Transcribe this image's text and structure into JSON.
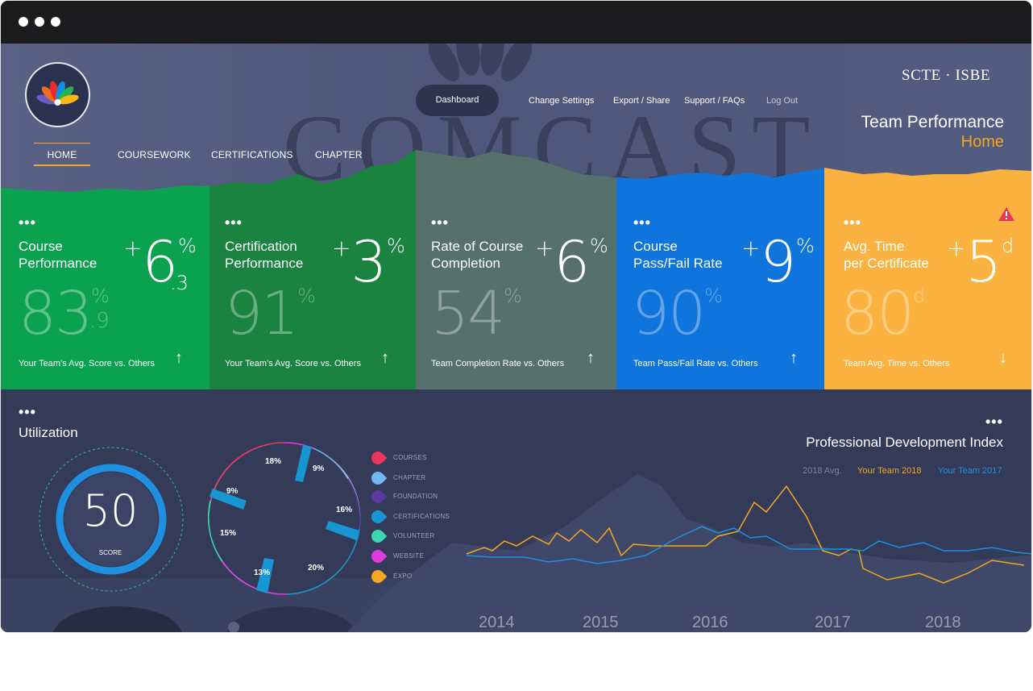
{
  "window": {
    "controls": [
      "close",
      "minimize",
      "maximize"
    ]
  },
  "header": {
    "brand": "SCTE · ISBE",
    "page_title": "Team Performance",
    "page_subtitle": "Home",
    "background_word": "COMCAST"
  },
  "nav": {
    "tabs": [
      {
        "label": "HOME",
        "active": true
      },
      {
        "label": "COURSEWORK"
      },
      {
        "label": "CERTIFICATIONS"
      },
      {
        "label": "CHAPTER"
      }
    ]
  },
  "top_menu": {
    "dashboard": "Dashboard",
    "change_settings": "Change Settings",
    "export_share": "Export / Share",
    "support": "Support / FAQs",
    "logout": "Log Out"
  },
  "cards": [
    {
      "title": "Course\nPerformance",
      "delta_sign": "+",
      "delta": "6",
      "delta_unit": "%",
      "delta_dec": ".3",
      "value": "83",
      "value_unit": "%",
      "value_dec": ".9",
      "footer": "Your Team’s Avg. Score vs. Others",
      "trend": "↑",
      "color": "#0aa24f"
    },
    {
      "title": "Certification\nPerformance",
      "delta_sign": "+",
      "delta": "3",
      "delta_unit": "%",
      "delta_dec": "",
      "value": "91",
      "value_unit": "%",
      "value_dec": "",
      "footer": "Your Team’s Avg. Score vs. Others",
      "trend": "↑",
      "color": "#1a8340"
    },
    {
      "title": "Rate of Course\nCompletion",
      "delta_sign": "+",
      "delta": "6",
      "delta_unit": "%",
      "delta_dec": "",
      "value": "54",
      "value_unit": "%",
      "value_dec": "",
      "footer": "Team Completion Rate vs. Others",
      "trend": "↑",
      "color": "#56706b"
    },
    {
      "title": "Course\nPass/Fail Rate",
      "delta_sign": "+",
      "delta": "9",
      "delta_unit": "%",
      "delta_dec": "",
      "value": "90",
      "value_unit": "%",
      "value_dec": "",
      "footer": "Team Pass/Fail Rate vs. Others",
      "trend": "↑",
      "color": "#0f74dc"
    },
    {
      "title": "Avg. Time\nper Certificate",
      "delta_sign": "+",
      "delta": "5",
      "delta_unit": "d",
      "delta_dec": "",
      "value": "80",
      "value_unit": "d",
      "value_dec": "",
      "footer": "Team Avg. Time vs. Others",
      "trend": "↓",
      "color": "#fbb240",
      "warning": true
    }
  ],
  "utilization": {
    "title": "Utilization",
    "score_value": "50",
    "score_label": "SCORE",
    "slices": [
      {
        "label": "COURSES",
        "percent": "18%",
        "color": "#e8365d"
      },
      {
        "label": "CHAPTER",
        "percent": "9%",
        "color": "#6fb7f0"
      },
      {
        "label": "FOUNDATION",
        "percent": "16%",
        "color": "#5a3aa0"
      },
      {
        "label": "CERTIFICATIONS",
        "percent": "20%",
        "color": "#1896d3"
      },
      {
        "label": "VOLUNTEER",
        "percent": "13%",
        "color": "#3ad7b0"
      },
      {
        "label": "WEBSITE",
        "percent": "15%",
        "color": "#e03ae0"
      },
      {
        "label": "EXPO",
        "percent": "9%",
        "color": "#f5a623"
      }
    ]
  },
  "pdi": {
    "title": "Professional Development Index",
    "legend": [
      {
        "label": "2018 Avg.",
        "color": "#7a82a0"
      },
      {
        "label": "Your Team 2018",
        "color": "#f5a623"
      },
      {
        "label": "Your Team 2017",
        "color": "#1f8fe0"
      }
    ],
    "years": [
      "2014",
      "2015",
      "2016",
      "2017",
      "2018"
    ]
  }
}
